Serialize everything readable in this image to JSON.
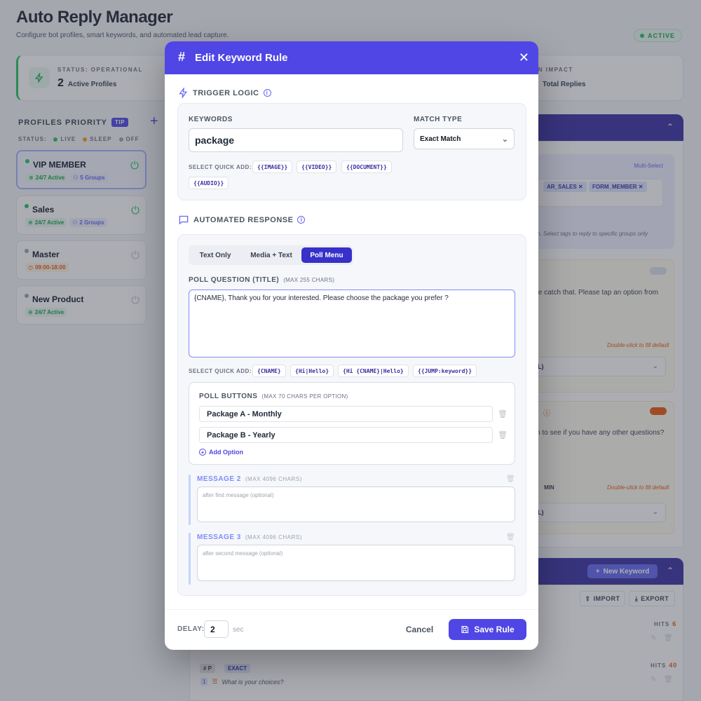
{
  "app": {
    "title": "Auto Reply Manager",
    "subtitle": "Configure bot profiles, smart keywords, and automated lead capture.",
    "status_badge": "ACTIVE"
  },
  "stats": {
    "status_label": "STATUS: OPERATIONAL",
    "active_count": "2",
    "active_label": "Active Profiles",
    "impact_label": "ON IMPACT",
    "impact_value": "Total Replies"
  },
  "profiles": {
    "title": "PROFILES PRIORITY",
    "tip": "TIP",
    "status_legend": {
      "label": "STATUS:",
      "live": "LIVE",
      "sleep": "SLEEP",
      "off": "OFF"
    },
    "items": [
      {
        "name": "VIP MEMBER",
        "tag1": "24/7 Active",
        "tag2": "5 Groups"
      },
      {
        "name": "Sales",
        "tag1": "24/7 Active",
        "tag2": "2 Groups"
      },
      {
        "name": "Master",
        "tag1": "09:00-18:00"
      },
      {
        "name": "New Product",
        "tag1": "24/7 Active"
      }
    ]
  },
  "right_panel": {
    "multi_select": "Multi-Select",
    "chips": [
      "AR_SALES",
      "FORM_MEMBER"
    ],
    "note": "n. Select tags to reply to specific groups only",
    "panel1_text": "te catch that. Please tap an option from",
    "panel1_hint": "Double-click to fill default",
    "panel1_select": "L)",
    "panel2_text": "n to see if you have any other questions?",
    "panel2_min": "MIN",
    "panel2_hint": "Double-click to fill default",
    "panel2_select": "L)"
  },
  "keywords": {
    "new_button": "New Keyword",
    "import": "IMPORT",
    "export": "EXPORT",
    "rows": [
      {
        "hits_label": "HITS",
        "hits": "6"
      },
      {
        "hits_label": "HITS",
        "hits": "40",
        "tag1": "# P",
        "tag2": "EXACT",
        "num": "1",
        "question": "What is your choices?"
      }
    ]
  },
  "modal": {
    "title": "Edit Keyword Rule",
    "trigger": {
      "heading": "TRIGGER LOGIC",
      "keywords_label": "KEYWORDS",
      "keywords_value": "package",
      "match_label": "MATCH TYPE",
      "match_value": "Exact Match",
      "quick_add_label": "SELECT QUICK ADD:",
      "quick_add": [
        "{{IMAGE}}",
        "{{VIDEO}}",
        "{{DOCUMENT}}",
        "{{AUDIO}}"
      ]
    },
    "response": {
      "heading": "AUTOMATED RESPONSE",
      "tabs": [
        "Text Only",
        "Media + Text",
        "Poll Menu"
      ],
      "question_label": "POLL QUESTION (TITLE)",
      "question_limit": "(MAX 255 CHARS)",
      "question_value": "{CNAME}, Thank you for your interested. Please choose the package you prefer ?",
      "quick_add_label": "SELECT QUICK ADD:",
      "quick_add": [
        "{CNAME}",
        "{Hi|Hello}",
        "{Hi {CNAME}|Hello}",
        "{{JUMP:keyword}}"
      ],
      "buttons_label": "POLL BUTTONS",
      "buttons_limit": "(MAX 70 CHARS PER OPTION)",
      "options": [
        "Package A - Monthly",
        "Package B - Yearly"
      ],
      "add_option": "Add Option",
      "message2_label": "MESSAGE 2",
      "message2_limit": "(MAX 4096 CHARS)",
      "message2_placeholder": "after first message (optional)",
      "message3_label": "MESSAGE 3",
      "message3_limit": "(MAX 4096 CHARS)",
      "message3_placeholder": "after second message (optional)"
    },
    "footer": {
      "delay_label": "DELAY:",
      "delay_value": "2",
      "delay_unit": "sec",
      "cancel": "Cancel",
      "save": "Save Rule"
    }
  },
  "colors": {
    "accent": "#4f46e5",
    "live": "#22c55e",
    "sleep": "#f59e0b",
    "off": "#9ca3af"
  }
}
